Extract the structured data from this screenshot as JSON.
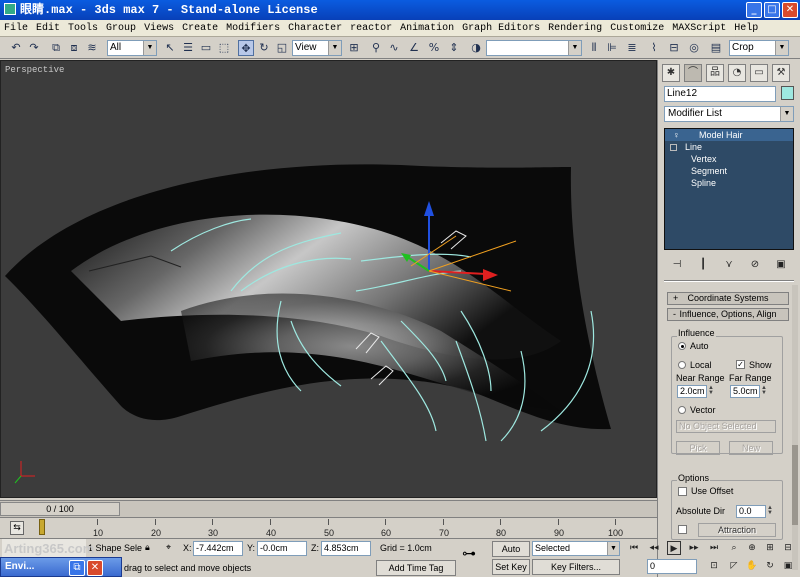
{
  "window": {
    "title": "眼睛.max - 3ds max 7  - Stand-alone License",
    "min": "_",
    "max": "□",
    "close": "✕"
  },
  "menu": [
    "File",
    "Edit",
    "Tools",
    "Group",
    "Views",
    "Create",
    "Modifiers",
    "Character",
    "reactor",
    "Animation",
    "Graph Editors",
    "Rendering",
    "Customize",
    "MAXScript",
    "Help"
  ],
  "toolbar": {
    "selection_filter": "All",
    "ref_coord": "View",
    "named_sel": "",
    "render_type": "Crop"
  },
  "viewport": {
    "label": "Perspective"
  },
  "command_panel": {
    "object_name": "Line12",
    "object_color": "#9ee8e0",
    "modifier_list": "Modifier List",
    "stack": {
      "top": "Model Hair",
      "base": "Line",
      "subs": [
        "Vertex",
        "Segment",
        "Spline"
      ]
    },
    "rollouts": {
      "coord": "Coordinate Systems",
      "influence": "Influence, Options, Align",
      "coord_pm": "+",
      "influence_pm": "-"
    },
    "influence": {
      "group": "Influence",
      "auto": "Auto",
      "local": "Local",
      "show": "Show",
      "near_range_label": "Near Range",
      "far_range_label": "Far Range",
      "near_range": "2.0cm",
      "far_range": "5.0cm",
      "vector": "Vector",
      "no_object": "No Object Selected",
      "pick": "Pick",
      "new": "New"
    },
    "options": {
      "group": "Options",
      "use_offset": "Use Offset",
      "absolute_dir": "Absolute Dir",
      "absolute_dir_val": "0.0",
      "attraction": "Attraction"
    }
  },
  "timeline": {
    "frame": "0 / 100",
    "ticks": [
      "10",
      "20",
      "30",
      "40",
      "50",
      "60",
      "70",
      "80",
      "90",
      "100"
    ]
  },
  "status": {
    "selection": "1 Shape Sele",
    "prompt": "drag to select and move objects",
    "x_label": "X:",
    "x": "-7.442cm",
    "y_label": "Y:",
    "y": "-0.0cm",
    "z_label": "Z:",
    "z": "4.853cm",
    "grid": "Grid = 1.0cm",
    "add_time_tag": "Add Time Tag",
    "auto_key": "Auto Key",
    "set_key": "Set Key",
    "key_mode": "Selected",
    "key_filters": "Key Filters...",
    "frame_field": "0"
  },
  "watermark": "Arting365.com",
  "taskbar": {
    "label": "Envi..."
  }
}
